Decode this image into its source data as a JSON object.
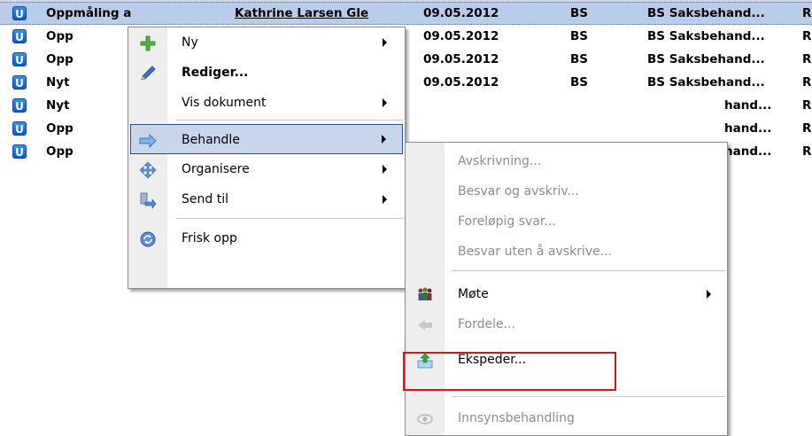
{
  "rows": [
    {
      "icon": "U",
      "title": "Oppmåling a",
      "person": "Kathrine Larsen Gle",
      "date": "09.05.2012",
      "code": "BS",
      "group": "BS Saksbehand...",
      "r": "R"
    },
    {
      "icon": "U",
      "title": "Opp",
      "person": "",
      "date": "09.05.2012",
      "code": "BS",
      "group": "BS Saksbehand...",
      "r": "R"
    },
    {
      "icon": "U",
      "title": "Opp",
      "person": "",
      "date": "09.05.2012",
      "code": "BS",
      "group": "BS Saksbehand...",
      "r": "R"
    },
    {
      "icon": "U",
      "title": "Nyt",
      "person": "",
      "date": "09.05.2012",
      "code": "BS",
      "group": "BS Saksbehand...",
      "r": "R"
    },
    {
      "icon": "U",
      "title": "Nyt",
      "person": "",
      "date": "",
      "code": "",
      "group": "hand...",
      "r": "R"
    },
    {
      "icon": "U",
      "title": "Opp",
      "person": "",
      "date": "",
      "code": "",
      "group": "hand...",
      "r": "R"
    },
    {
      "icon": "U",
      "title": "Opp",
      "person": "",
      "date": "",
      "code": "",
      "group": "hand...",
      "r": "R"
    }
  ],
  "context_menu": {
    "items": [
      {
        "label": "Ny",
        "icon": "new-plus-icon",
        "submenu": true
      },
      {
        "label": "Rediger...",
        "icon": "pencil-icon",
        "bold": true
      },
      {
        "label": "Vis dokument",
        "submenu": true
      },
      {
        "label": "Behandle",
        "icon": "process-arrow-icon",
        "submenu": true,
        "active": true
      },
      {
        "label": "Organisere",
        "icon": "organize-arrows-icon",
        "submenu": true
      },
      {
        "label": "Send til",
        "icon": "send-to-icon",
        "submenu": true
      },
      {
        "label": "Frisk opp",
        "icon": "refresh-icon"
      }
    ]
  },
  "submenu": {
    "items": [
      {
        "label": "Avskrivning...",
        "disabled": true
      },
      {
        "label": "Besvar og avskriv...",
        "disabled": true
      },
      {
        "label": "Foreløpig svar...",
        "disabled": true
      },
      {
        "label": "Besvar uten å avskrive...",
        "disabled": true
      },
      {
        "label": "Møte",
        "icon": "meeting-people-icon",
        "submenu": true
      },
      {
        "label": "Fordele...",
        "icon": "distribute-icon",
        "disabled": true
      },
      {
        "label": "Ekspeder...",
        "icon": "dispatch-icon",
        "highlighted": true
      },
      {
        "label": "Innsynsbehandling",
        "icon": "eye-icon",
        "disabled": true
      }
    ]
  },
  "colors": {
    "highlight_border": "#e0101a",
    "selected_row": "#b9cdea",
    "icon_blue": "#0c5ac5"
  }
}
